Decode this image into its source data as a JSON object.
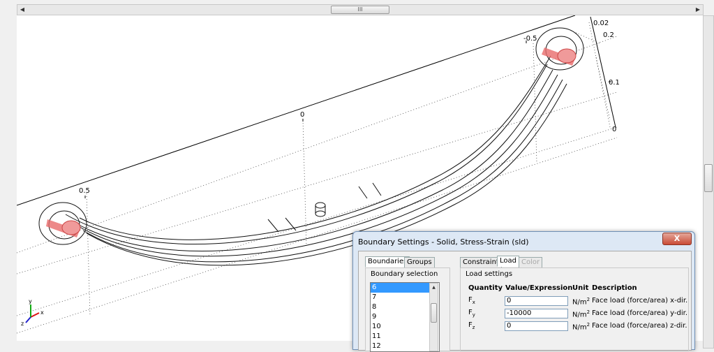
{
  "hscroll": {
    "grip": "III"
  },
  "axes": {
    "front_left": "0.5",
    "front_mid": "0",
    "front_right": "-0.5",
    "z_top": "0.2",
    "z_mid": "0.1",
    "z_bottom": "0",
    "corner": "0.02"
  },
  "triad": {
    "x": "x",
    "y": "y",
    "z": "z"
  },
  "dialog": {
    "title": "Boundary Settings - Solid, Stress-Strain (sld)",
    "close": "X",
    "left_tabs": [
      "Boundaries",
      "Groups"
    ],
    "boundary_selection_label": "Boundary selection",
    "boundary_items": [
      "6",
      "7",
      "8",
      "9",
      "10",
      "11",
      "12"
    ],
    "selected_boundary": "6",
    "right_tabs": [
      "Constraint",
      "Load",
      "Color"
    ],
    "load_settings_label": "Load settings",
    "columns": {
      "quantity": "Quantity",
      "value": "Value/Expression",
      "unit": "Unit",
      "description": "Description"
    },
    "rows": [
      {
        "quantity": "F",
        "sub": "x",
        "value": "0",
        "unit": "N/m",
        "sup": "2",
        "description": "Face load (force/area) x-dir."
      },
      {
        "quantity": "F",
        "sub": "y",
        "value": "-10000",
        "unit": "N/m",
        "sup": "2",
        "description": "Face load (force/area) y-dir."
      },
      {
        "quantity": "F",
        "sub": "z",
        "value": "0",
        "unit": "N/m",
        "sup": "2",
        "description": "Face load (force/area) z-dir."
      }
    ]
  }
}
